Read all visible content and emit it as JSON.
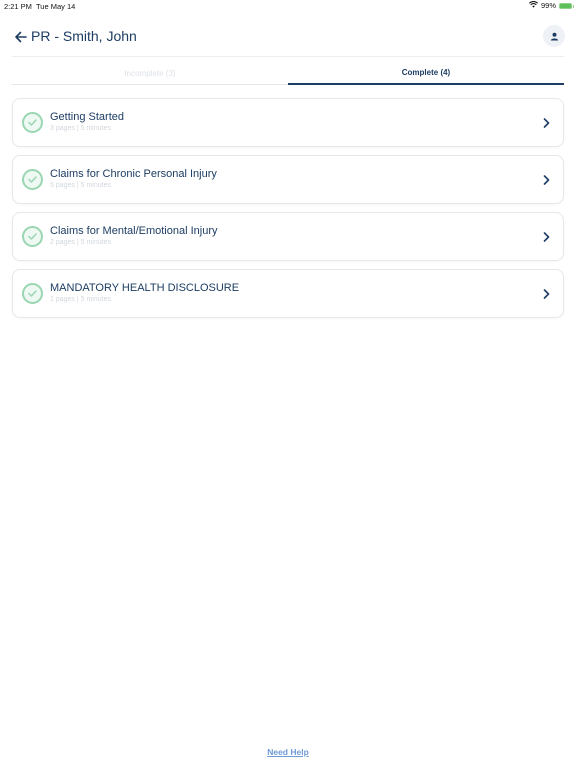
{
  "status_bar": {
    "time": "2:21 PM",
    "date": "Tue May 14",
    "battery": "99%"
  },
  "header": {
    "title": "PR - Smith, John"
  },
  "tabs": [
    {
      "label": "Incomplete (3)",
      "active": false
    },
    {
      "label": "Complete (4)",
      "active": true
    }
  ],
  "sections": [
    {
      "title": "Getting Started",
      "meta": "3 pages | 5 minutes",
      "status": "complete"
    },
    {
      "title": "Claims for Chronic Personal Injury",
      "meta": "5 pages | 5 minutes",
      "status": "complete"
    },
    {
      "title": "Claims for Mental/Emotional Injury",
      "meta": "2 pages | 5 minutes",
      "status": "complete"
    },
    {
      "title": "MANDATORY HEALTH DISCLOSURE",
      "meta": "1 pages | 5 minutes",
      "status": "complete"
    }
  ],
  "footer": {
    "help_label": "Need Help"
  },
  "colors": {
    "primary": "#1d3d63",
    "check_green": "#9ad6b1",
    "link": "#6f9ad6"
  }
}
